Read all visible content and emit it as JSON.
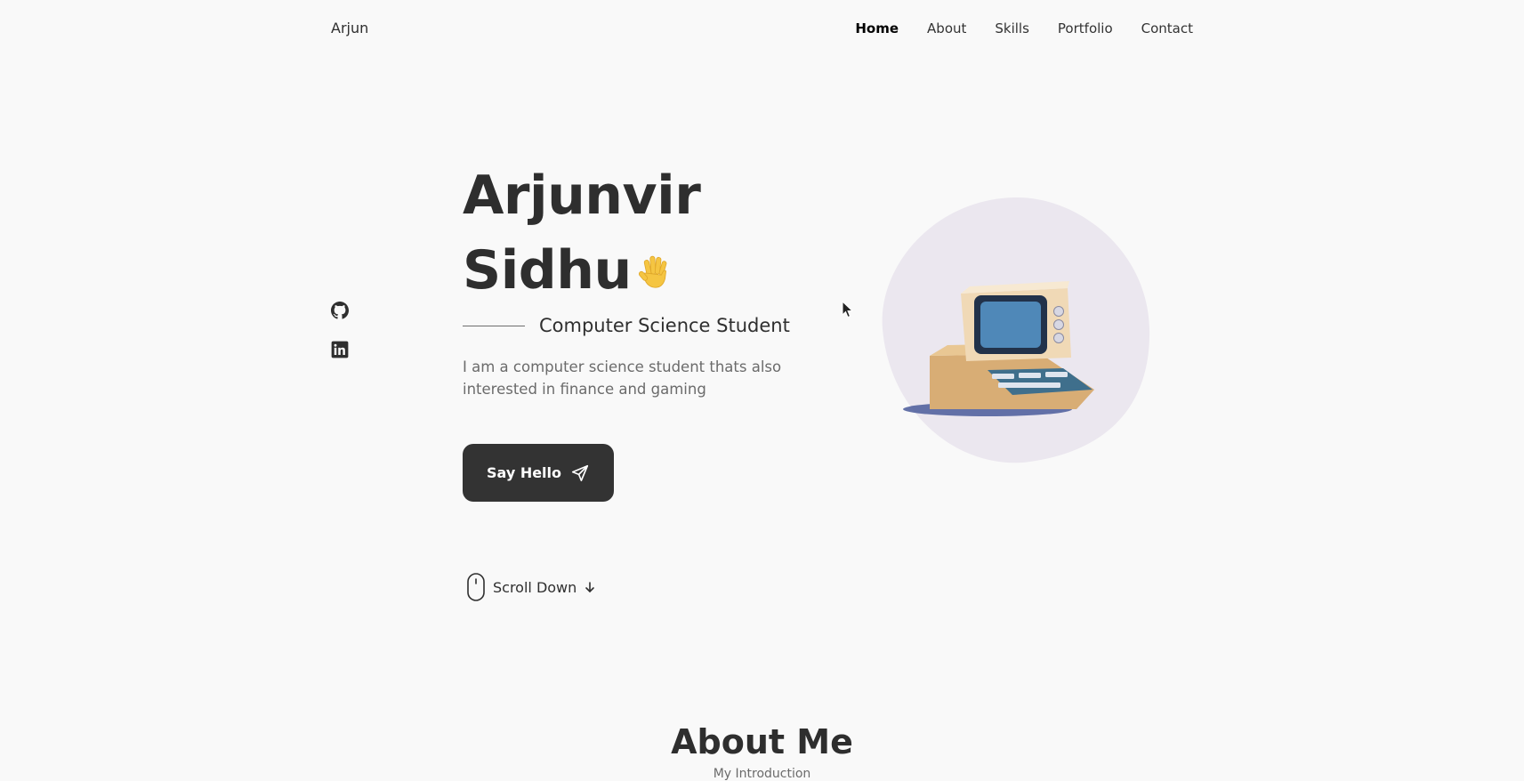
{
  "header": {
    "logo": "Arjun",
    "nav": [
      "Home",
      "About",
      "Skills",
      "Portfolio",
      "Contact"
    ],
    "active": "Home"
  },
  "social": {
    "items": [
      {
        "icon": "github-icon"
      },
      {
        "icon": "linkedin-icon"
      }
    ]
  },
  "hero": {
    "title_line1": "Arjunvir",
    "title_line2": "Sidhu",
    "subtitle": "Computer Science Student",
    "description": "I am a computer science student thats also interested in finance and gaming",
    "button_label": "Say Hello",
    "scroll_label": "Scroll Down"
  },
  "about": {
    "title": "About Me",
    "subtitle": "My Introduction"
  },
  "colors": {
    "background": "#f9f9f9",
    "text_dark": "#2f2f2f",
    "button_bg": "#333333",
    "blob": "#ebe7ef"
  }
}
